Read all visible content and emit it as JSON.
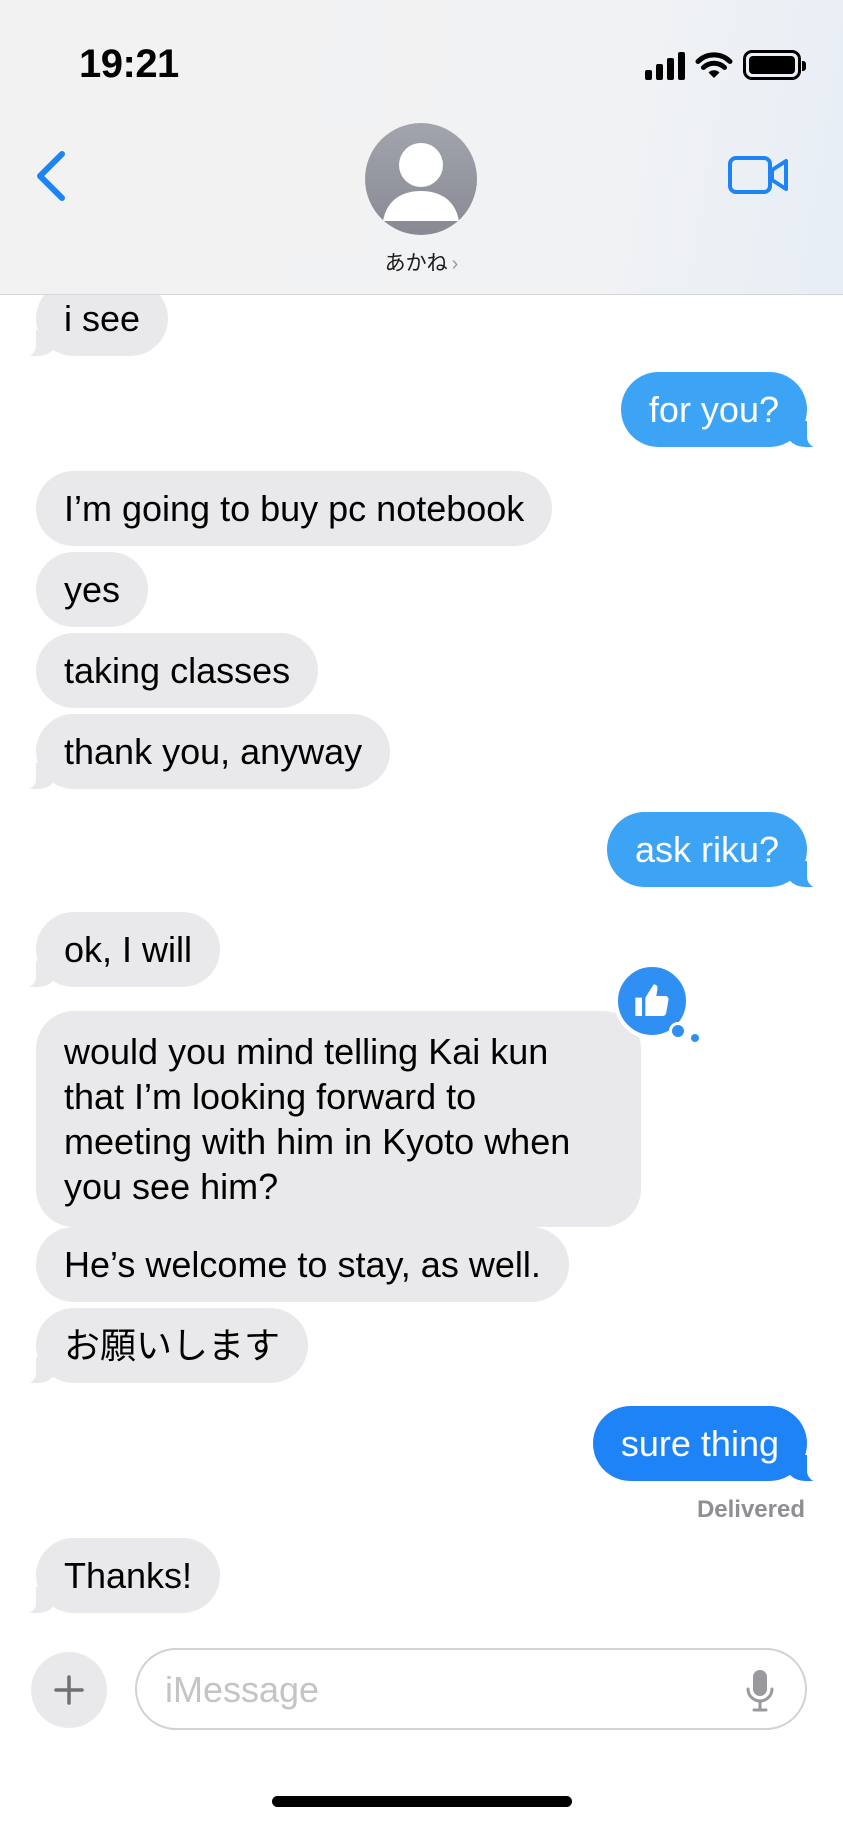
{
  "status_bar": {
    "time": "19:21"
  },
  "header": {
    "contact_name": "あかね",
    "chevron": "›"
  },
  "messages": [
    {
      "from": "them",
      "text": "i see"
    },
    {
      "from": "me",
      "text": "for you?"
    },
    {
      "from": "them",
      "text": "I’m going to buy pc notebook"
    },
    {
      "from": "them",
      "text": "yes"
    },
    {
      "from": "them",
      "text": "taking classes"
    },
    {
      "from": "them",
      "text": "thank you, anyway"
    },
    {
      "from": "me",
      "text": "ask riku?"
    },
    {
      "from": "them",
      "text": "ok, I will"
    },
    {
      "from": "them",
      "text": "would you mind telling Kai kun that I’m looking forward to meeting with him in Kyoto when you see him?",
      "reaction": "thumbs-up"
    },
    {
      "from": "them",
      "text": "He’s welcome to stay, as well."
    },
    {
      "from": "them",
      "text": "お願いします"
    },
    {
      "from": "me",
      "text": "sure thing"
    },
    {
      "from": "them",
      "text": "Thanks!"
    }
  ],
  "delivery_status": "Delivered",
  "composer": {
    "placeholder": "iMessage"
  },
  "colors": {
    "accent": "#1e83f7",
    "sent_bubble": "#3da3f5",
    "received_bubble": "#e9e9eb"
  },
  "icons": {
    "back": "chevron-left-icon",
    "video": "video-camera-icon",
    "plus": "plus-icon",
    "mic": "microphone-icon",
    "reaction": "thumbs-up-icon"
  }
}
